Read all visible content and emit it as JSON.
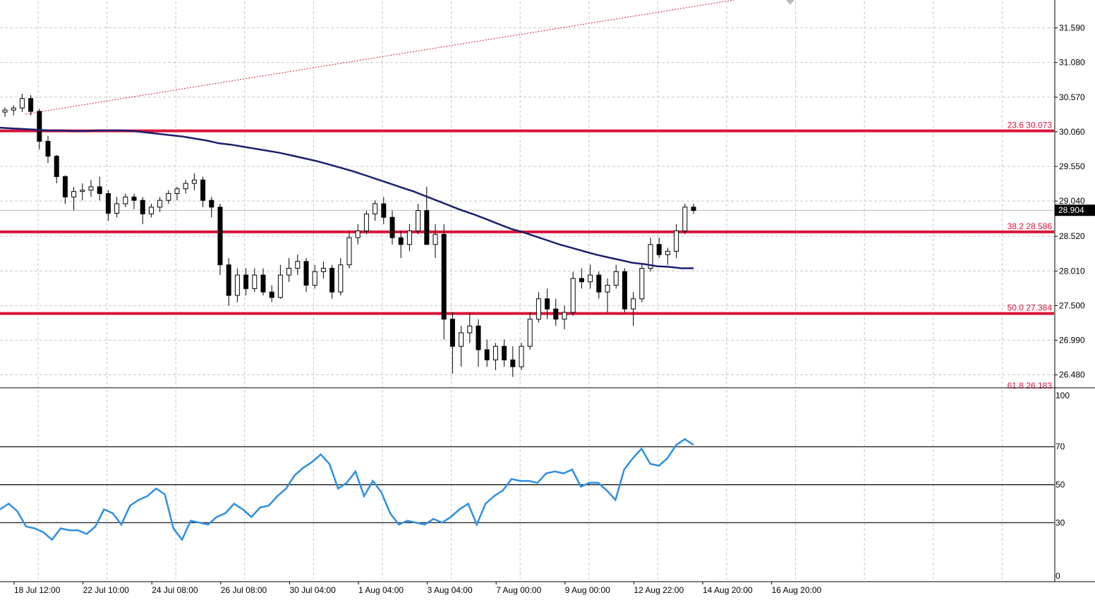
{
  "chart_data": [
    {
      "type": "candlestick",
      "title": "",
      "price_axis": {
        "ticks": [
          "31.590",
          "31.080",
          "30.570",
          "30.060",
          "29.550",
          "29.040",
          "28.520",
          "28.010",
          "27.500",
          "26.990",
          "26.480"
        ],
        "tick_values": [
          31.59,
          31.08,
          30.57,
          30.06,
          29.55,
          29.04,
          28.52,
          28.01,
          27.5,
          26.99,
          26.48
        ],
        "ylim": [
          26.3,
          31.98
        ],
        "current_price": 28.904,
        "current_price_label": "28.904"
      },
      "time_axis": {
        "labels": [
          "18 Jul 12:00",
          "22 Jul 10:00",
          "24 Jul 08:00",
          "26 Jul 08:00",
          "30 Jul 04:00",
          "1 Aug 04:00",
          "3 Aug 04:00",
          "7 Aug 00:00",
          "9 Aug 00:00",
          "12 Aug 22:00",
          "14 Aug 20:00",
          "16 Aug 20:00"
        ]
      },
      "fibonacci_levels": [
        {
          "level": "23.6",
          "price": 30.073,
          "label": "23.6 30.073"
        },
        {
          "level": "38.2",
          "price": 28.586,
          "label": "38.2 28.586"
        },
        {
          "level": "50.0",
          "price": 27.384,
          "label": "50.0 27.384"
        },
        {
          "level": "61.8",
          "price": 26.18,
          "label": "61.8 26.183"
        }
      ],
      "trendline": {
        "start_price": 30.32,
        "end_price": 32.0,
        "style": "dotted",
        "color": "#cc2233"
      },
      "moving_average": {
        "color": "#1a1f6e",
        "values": [
          30.12,
          30.11,
          30.1,
          30.09,
          30.08,
          30.08,
          30.07,
          30.07,
          30.08,
          30.08,
          30.08,
          30.07,
          30.05,
          30.03,
          30.01,
          29.99,
          29.96,
          29.93,
          29.89,
          29.87,
          29.84,
          29.81,
          29.78,
          29.75,
          29.71,
          29.67,
          29.63,
          29.58,
          29.53,
          29.48,
          29.42,
          29.36,
          29.3,
          29.24,
          29.18,
          29.11,
          29.04,
          28.97,
          28.9,
          28.84,
          28.77,
          28.7,
          28.63,
          28.58,
          28.52,
          28.46,
          28.4,
          28.35,
          28.3,
          28.25,
          28.21,
          28.17,
          28.13,
          28.11,
          28.08,
          28.07,
          28.05,
          28.05
        ]
      },
      "candles": [
        [
          30.35,
          30.42,
          30.28,
          30.38
        ],
        [
          30.38,
          30.45,
          30.3,
          30.41
        ],
        [
          30.41,
          30.62,
          30.35,
          30.55
        ],
        [
          30.55,
          30.6,
          30.3,
          30.36
        ],
        [
          30.36,
          30.4,
          29.8,
          29.92
        ],
        [
          29.92,
          30.0,
          29.6,
          29.7
        ],
        [
          29.7,
          29.72,
          29.3,
          29.4
        ],
        [
          29.4,
          29.42,
          29.0,
          29.1
        ],
        [
          29.1,
          29.25,
          28.9,
          29.18
        ],
        [
          29.18,
          29.3,
          29.05,
          29.2
        ],
        [
          29.2,
          29.35,
          29.1,
          29.25
        ],
        [
          29.25,
          29.4,
          29.05,
          29.15
        ],
        [
          29.15,
          29.2,
          28.75,
          28.86
        ],
        [
          28.86,
          29.1,
          28.8,
          29.0
        ],
        [
          29.0,
          29.15,
          28.95,
          29.1
        ],
        [
          29.1,
          29.15,
          28.92,
          29.05
        ],
        [
          29.05,
          29.1,
          28.7,
          28.85
        ],
        [
          28.85,
          29.0,
          28.8,
          28.95
        ],
        [
          28.95,
          29.1,
          28.88,
          29.05
        ],
        [
          29.05,
          29.2,
          29.0,
          29.15
        ],
        [
          29.15,
          29.25,
          29.05,
          29.22
        ],
        [
          29.22,
          29.35,
          29.15,
          29.3
        ],
        [
          29.3,
          29.45,
          29.2,
          29.35
        ],
        [
          29.35,
          29.4,
          28.95,
          29.05
        ],
        [
          29.05,
          29.1,
          28.8,
          28.95
        ],
        [
          28.95,
          29.0,
          27.95,
          28.1
        ],
        [
          28.1,
          28.2,
          27.5,
          27.65
        ],
        [
          27.65,
          28.05,
          27.55,
          27.95
        ],
        [
          27.95,
          28.05,
          27.65,
          27.75
        ],
        [
          27.75,
          28.05,
          27.7,
          27.95
        ],
        [
          27.95,
          28.05,
          27.65,
          27.7
        ],
        [
          27.7,
          27.8,
          27.55,
          27.62
        ],
        [
          27.62,
          28.1,
          27.6,
          27.95
        ],
        [
          27.95,
          28.2,
          27.85,
          28.05
        ],
        [
          28.05,
          28.25,
          27.95,
          28.15
        ],
        [
          28.15,
          28.2,
          27.7,
          27.8
        ],
        [
          27.8,
          28.1,
          27.75,
          28.0
        ],
        [
          28.0,
          28.15,
          27.9,
          28.05
        ],
        [
          28.05,
          28.1,
          27.6,
          27.7
        ],
        [
          27.7,
          28.2,
          27.65,
          28.1
        ],
        [
          28.1,
          28.6,
          28.05,
          28.5
        ],
        [
          28.5,
          28.7,
          28.4,
          28.6
        ],
        [
          28.6,
          28.9,
          28.55,
          28.85
        ],
        [
          28.85,
          29.05,
          28.75,
          29.0
        ],
        [
          29.0,
          29.1,
          28.7,
          28.8
        ],
        [
          28.8,
          28.9,
          28.4,
          28.5
        ],
        [
          28.5,
          28.6,
          28.2,
          28.4
        ],
        [
          28.4,
          28.7,
          28.3,
          28.6
        ],
        [
          28.6,
          29.0,
          28.55,
          28.9
        ],
        [
          28.9,
          29.25,
          28.8,
          28.4
        ],
        [
          28.4,
          28.7,
          28.2,
          28.55
        ],
        [
          28.55,
          28.7,
          27.0,
          27.3
        ],
        [
          27.3,
          27.4,
          26.5,
          26.9
        ],
        [
          26.9,
          27.2,
          26.6,
          27.1
        ],
        [
          27.1,
          27.4,
          26.95,
          27.2
        ],
        [
          27.2,
          27.3,
          26.6,
          26.85
        ],
        [
          26.85,
          27.0,
          26.6,
          26.7
        ],
        [
          26.7,
          26.95,
          26.55,
          26.9
        ],
        [
          26.9,
          27.0,
          26.6,
          26.7
        ],
        [
          26.7,
          26.9,
          26.45,
          26.6
        ],
        [
          26.6,
          26.95,
          26.55,
          26.9
        ],
        [
          26.9,
          27.4,
          26.85,
          27.3
        ],
        [
          27.3,
          27.7,
          27.25,
          27.6
        ],
        [
          27.6,
          27.75,
          27.3,
          27.45
        ],
        [
          27.45,
          27.6,
          27.2,
          27.3
        ],
        [
          27.3,
          27.5,
          27.15,
          27.4
        ],
        [
          27.4,
          28.0,
          27.35,
          27.9
        ],
        [
          27.9,
          28.05,
          27.75,
          27.85
        ],
        [
          27.85,
          28.1,
          27.75,
          27.95
        ],
        [
          27.95,
          28.0,
          27.6,
          27.7
        ],
        [
          27.7,
          27.9,
          27.4,
          27.8
        ],
        [
          27.8,
          28.1,
          27.75,
          28.0
        ],
        [
          28.0,
          28.05,
          27.4,
          27.45
        ],
        [
          27.45,
          27.7,
          27.2,
          27.6
        ],
        [
          27.6,
          28.1,
          27.55,
          28.05
        ],
        [
          28.05,
          28.5,
          28.0,
          28.4
        ],
        [
          28.4,
          28.5,
          28.2,
          28.25
        ],
        [
          28.25,
          28.35,
          28.1,
          28.3
        ],
        [
          28.3,
          28.7,
          28.2,
          28.6
        ],
        [
          28.6,
          29.0,
          28.55,
          28.95
        ],
        [
          28.95,
          29.0,
          28.85,
          28.9
        ]
      ]
    },
    {
      "type": "line",
      "title": "",
      "y_ticks": [
        "100",
        "70",
        "50",
        "30",
        "0"
      ],
      "ylim": [
        0,
        100
      ],
      "levels": [
        70,
        50,
        30
      ],
      "level_labels": [
        "70",
        "50",
        "30"
      ],
      "color": "#2f8fe0",
      "values": [
        37,
        40,
        36,
        28,
        27,
        25,
        21,
        27,
        26,
        26,
        24,
        28,
        37,
        35,
        29,
        39,
        42,
        44,
        48,
        45,
        27,
        21,
        31,
        30,
        29,
        33,
        35,
        40,
        37,
        33,
        38,
        39,
        44,
        48,
        55,
        59,
        62,
        66,
        61,
        48,
        51,
        57,
        44,
        52,
        46,
        35,
        29,
        31,
        30,
        29,
        32,
        30,
        33,
        37,
        40,
        29,
        40,
        44,
        47,
        53,
        52,
        52,
        51,
        56,
        57,
        56,
        58,
        49,
        51,
        51,
        47,
        42,
        58,
        64,
        69,
        61,
        60,
        64,
        71,
        74,
        71
      ]
    }
  ]
}
